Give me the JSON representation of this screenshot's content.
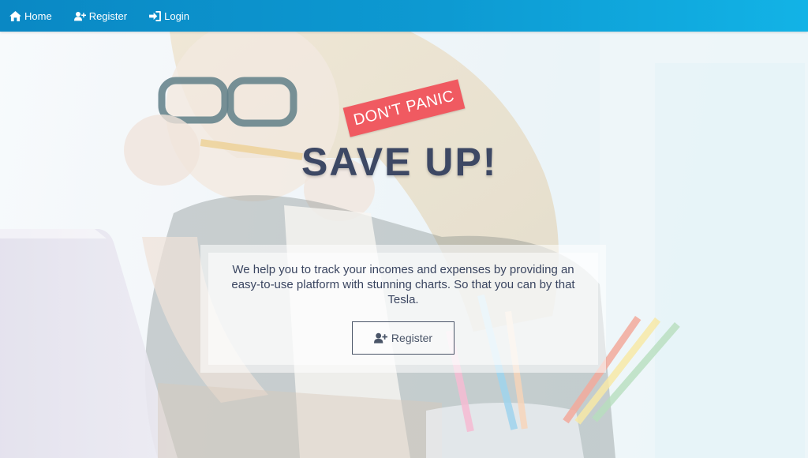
{
  "nav": {
    "items": [
      {
        "label": "Home",
        "icon": "home-icon"
      },
      {
        "label": "Register",
        "icon": "user-plus-icon"
      },
      {
        "label": "Login",
        "icon": "sign-in-icon"
      }
    ]
  },
  "hero": {
    "tag": "DON'T PANIC",
    "headline": "SAVE UP!",
    "tagline": "We help you to track your incomes and expenses by providing an easy-to-use platform with stunning charts. So that you can by that Tesla.",
    "cta_label": "Register",
    "cta_icon": "user-plus-icon"
  },
  "colors": {
    "navbar": "#0d9ad2",
    "tag": "#f05a61",
    "headline": "#3d4864"
  }
}
